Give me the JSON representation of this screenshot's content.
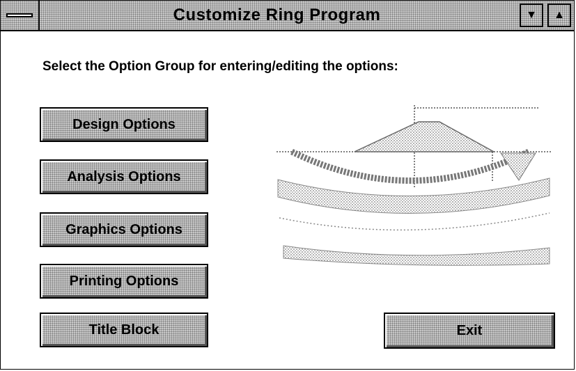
{
  "window": {
    "title": "Customize Ring Program"
  },
  "prompt": "Select the Option Group for entering/editing the options:",
  "buttons": {
    "design": "Design Options",
    "analysis": "Analysis Options",
    "graphics": "Graphics Options",
    "printing": "Printing Options",
    "title_block": "Title Block",
    "exit": "Exit"
  },
  "icons": {
    "system_menu": "system-menu-icon",
    "minimize": "minimize-icon",
    "maximize": "maximize-icon",
    "illustration": "ring-section-illustration"
  }
}
